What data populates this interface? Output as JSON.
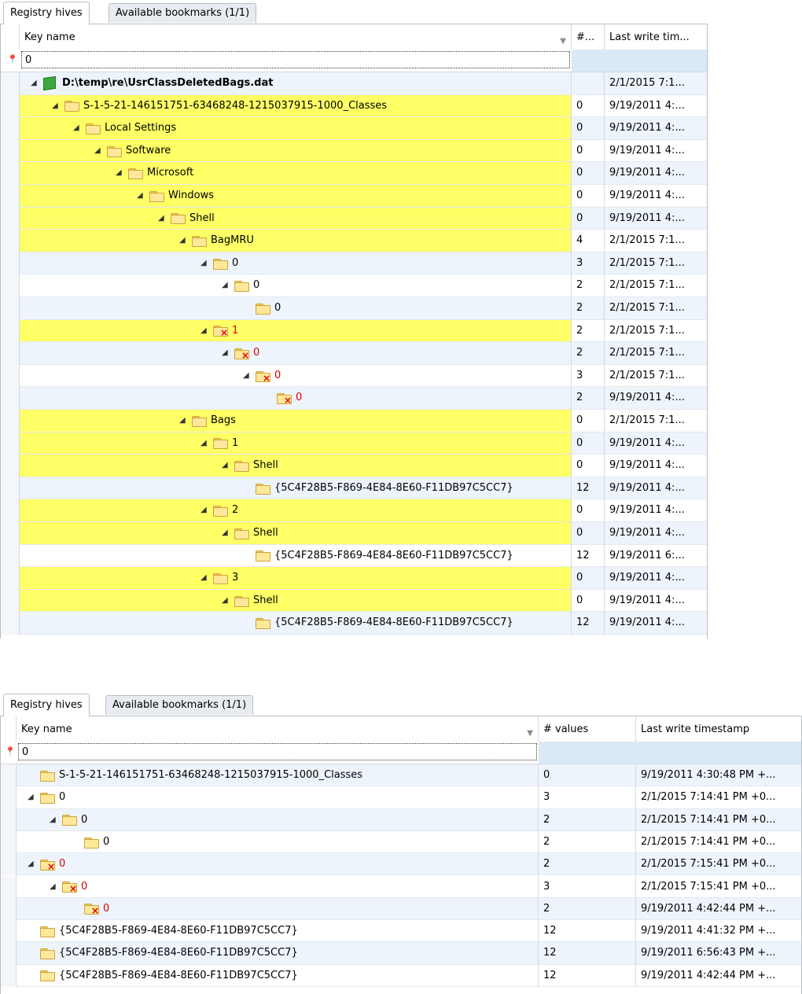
{
  "top_panel": {
    "tabs": [
      {
        "label": "Registry hives",
        "active": true
      },
      {
        "label": "Available bookmarks (1/1)",
        "active": false
      }
    ],
    "columns": {
      "key_name": "Key name",
      "values": "#...",
      "timestamp": "Last write tim..."
    },
    "filter_value": "0",
    "rows": [
      {
        "depth": 0,
        "icon": "hive-icon",
        "name": "D:\\temp\\re\\UsrClassDeletedBags.dat",
        "values": "",
        "timestamp": "2/1/2015 7:1...",
        "highlight": false,
        "deleted": false,
        "toggle": true,
        "bold": true
      },
      {
        "depth": 1,
        "icon": "folder-icon",
        "name": "S-1-5-21-146151751-63468248-1215037915-1000_Classes",
        "values": "0",
        "timestamp": "9/19/2011 4:...",
        "highlight": true,
        "deleted": false,
        "toggle": true
      },
      {
        "depth": 2,
        "icon": "folder-icon",
        "name": "Local Settings",
        "values": "0",
        "timestamp": "9/19/2011 4:...",
        "highlight": true,
        "deleted": false,
        "toggle": true
      },
      {
        "depth": 3,
        "icon": "folder-icon",
        "name": "Software",
        "values": "0",
        "timestamp": "9/19/2011 4:...",
        "highlight": true,
        "deleted": false,
        "toggle": true
      },
      {
        "depth": 4,
        "icon": "folder-icon",
        "name": "Microsoft",
        "values": "0",
        "timestamp": "9/19/2011 4:...",
        "highlight": true,
        "deleted": false,
        "toggle": true
      },
      {
        "depth": 5,
        "icon": "folder-icon",
        "name": "Windows",
        "values": "0",
        "timestamp": "9/19/2011 4:...",
        "highlight": true,
        "deleted": false,
        "toggle": true
      },
      {
        "depth": 6,
        "icon": "folder-icon",
        "name": "Shell",
        "values": "0",
        "timestamp": "9/19/2011 4:...",
        "highlight": true,
        "deleted": false,
        "toggle": true
      },
      {
        "depth": 7,
        "icon": "folder-icon",
        "name": "BagMRU",
        "values": "4",
        "timestamp": "2/1/2015 7:1...",
        "highlight": true,
        "deleted": false,
        "toggle": true
      },
      {
        "depth": 8,
        "icon": "folder-icon",
        "name": "0",
        "values": "3",
        "timestamp": "2/1/2015 7:1...",
        "highlight": false,
        "deleted": false,
        "toggle": true
      },
      {
        "depth": 9,
        "icon": "folder-icon",
        "name": "0",
        "values": "2",
        "timestamp": "2/1/2015 7:1...",
        "highlight": false,
        "deleted": false,
        "toggle": true
      },
      {
        "depth": 10,
        "icon": "folder-icon",
        "name": "0",
        "values": "2",
        "timestamp": "2/1/2015 7:1...",
        "highlight": false,
        "deleted": false,
        "toggle": false
      },
      {
        "depth": 8,
        "icon": "deleted-folder-icon",
        "name": "1",
        "values": "2",
        "timestamp": "2/1/2015 7:1...",
        "highlight": true,
        "deleted": true,
        "toggle": true
      },
      {
        "depth": 9,
        "icon": "deleted-folder-icon",
        "name": "0",
        "values": "2",
        "timestamp": "2/1/2015 7:1...",
        "highlight": false,
        "deleted": true,
        "toggle": true
      },
      {
        "depth": 10,
        "icon": "deleted-folder-icon",
        "name": "0",
        "values": "3",
        "timestamp": "2/1/2015 7:1...",
        "highlight": false,
        "deleted": true,
        "toggle": true
      },
      {
        "depth": 11,
        "icon": "deleted-folder-icon",
        "name": "0",
        "values": "2",
        "timestamp": "9/19/2011 4:...",
        "highlight": false,
        "deleted": true,
        "toggle": false
      },
      {
        "depth": 7,
        "icon": "folder-icon",
        "name": "Bags",
        "values": "0",
        "timestamp": "2/1/2015 7:1...",
        "highlight": true,
        "deleted": false,
        "toggle": true
      },
      {
        "depth": 8,
        "icon": "folder-icon",
        "name": "1",
        "values": "0",
        "timestamp": "9/19/2011 4:...",
        "highlight": true,
        "deleted": false,
        "toggle": true
      },
      {
        "depth": 9,
        "icon": "folder-icon",
        "name": "Shell",
        "values": "0",
        "timestamp": "9/19/2011 4:...",
        "highlight": true,
        "deleted": false,
        "toggle": true
      },
      {
        "depth": 10,
        "icon": "folder-icon",
        "name": "{5C4F28B5-F869-4E84-8E60-F11DB97C5CC7}",
        "values": "12",
        "timestamp": "9/19/2011 4:...",
        "highlight": false,
        "deleted": false,
        "toggle": false
      },
      {
        "depth": 8,
        "icon": "folder-icon",
        "name": "2",
        "values": "0",
        "timestamp": "9/19/2011 4:...",
        "highlight": true,
        "deleted": false,
        "toggle": true
      },
      {
        "depth": 9,
        "icon": "folder-icon",
        "name": "Shell",
        "values": "0",
        "timestamp": "9/19/2011 4:...",
        "highlight": true,
        "deleted": false,
        "toggle": true
      },
      {
        "depth": 10,
        "icon": "folder-icon",
        "name": "{5C4F28B5-F869-4E84-8E60-F11DB97C5CC7}",
        "values": "12",
        "timestamp": "9/19/2011 6:...",
        "highlight": false,
        "deleted": false,
        "toggle": false
      },
      {
        "depth": 8,
        "icon": "folder-icon",
        "name": "3",
        "values": "0",
        "timestamp": "9/19/2011 4:...",
        "highlight": true,
        "deleted": false,
        "toggle": true
      },
      {
        "depth": 9,
        "icon": "folder-icon",
        "name": "Shell",
        "values": "0",
        "timestamp": "9/19/2011 4:...",
        "highlight": true,
        "deleted": false,
        "toggle": true
      },
      {
        "depth": 10,
        "icon": "folder-icon",
        "name": "{5C4F28B5-F869-4E84-8E60-F11DB97C5CC7}",
        "values": "12",
        "timestamp": "9/19/2011 4:...",
        "highlight": false,
        "deleted": false,
        "toggle": false
      }
    ]
  },
  "bottom_panel": {
    "tabs": [
      {
        "label": "Registry hives",
        "active": true
      },
      {
        "label": "Available bookmarks (1/1)",
        "active": false
      }
    ],
    "columns": {
      "key_name": "Key name",
      "values": "# values",
      "timestamp": "Last write timestamp"
    },
    "filter_value": "0",
    "rows": [
      {
        "depth": 0,
        "icon": "folder-icon",
        "name": "S-1-5-21-146151751-63468248-1215037915-1000_Classes",
        "values": "0",
        "timestamp": "9/19/2011 4:30:48 PM +...",
        "deleted": false,
        "toggle": false
      },
      {
        "depth": 0,
        "icon": "folder-icon",
        "name": "0",
        "values": "3",
        "timestamp": "2/1/2015 7:14:41 PM +0...",
        "deleted": false,
        "toggle": true
      },
      {
        "depth": 1,
        "icon": "folder-icon",
        "name": "0",
        "values": "2",
        "timestamp": "2/1/2015 7:14:41 PM +0...",
        "deleted": false,
        "toggle": true
      },
      {
        "depth": 2,
        "icon": "folder-icon",
        "name": "0",
        "values": "2",
        "timestamp": "2/1/2015 7:14:41 PM +0...",
        "deleted": false,
        "toggle": false
      },
      {
        "depth": 0,
        "icon": "deleted-folder-icon",
        "name": "0",
        "values": "2",
        "timestamp": "2/1/2015 7:15:41 PM +0...",
        "deleted": true,
        "toggle": true
      },
      {
        "depth": 1,
        "icon": "deleted-folder-icon",
        "name": "0",
        "values": "3",
        "timestamp": "2/1/2015 7:15:41 PM +0...",
        "deleted": true,
        "toggle": true
      },
      {
        "depth": 2,
        "icon": "deleted-folder-icon",
        "name": "0",
        "values": "2",
        "timestamp": "9/19/2011 4:42:44 PM +...",
        "deleted": true,
        "toggle": false
      },
      {
        "depth": 0,
        "icon": "folder-icon",
        "name": "{5C4F28B5-F869-4E84-8E60-F11DB97C5CC7}",
        "values": "12",
        "timestamp": "9/19/2011 4:41:32 PM +...",
        "deleted": false,
        "toggle": false
      },
      {
        "depth": 0,
        "icon": "folder-icon",
        "name": "{5C4F28B5-F869-4E84-8E60-F11DB97C5CC7}",
        "values": "12",
        "timestamp": "9/19/2011 6:56:43 PM +...",
        "deleted": false,
        "toggle": false
      },
      {
        "depth": 0,
        "icon": "folder-icon",
        "name": "{5C4F28B5-F869-4E84-8E60-F11DB97C5CC7}",
        "values": "12",
        "timestamp": "9/19/2011 4:42:44 PM +...",
        "deleted": false,
        "toggle": false
      }
    ]
  },
  "colors": {
    "highlight": "#ffff66",
    "deleted_text": "#e00000",
    "alt_row": "#eef4fb",
    "filter_cell": "#dbe9f6"
  }
}
